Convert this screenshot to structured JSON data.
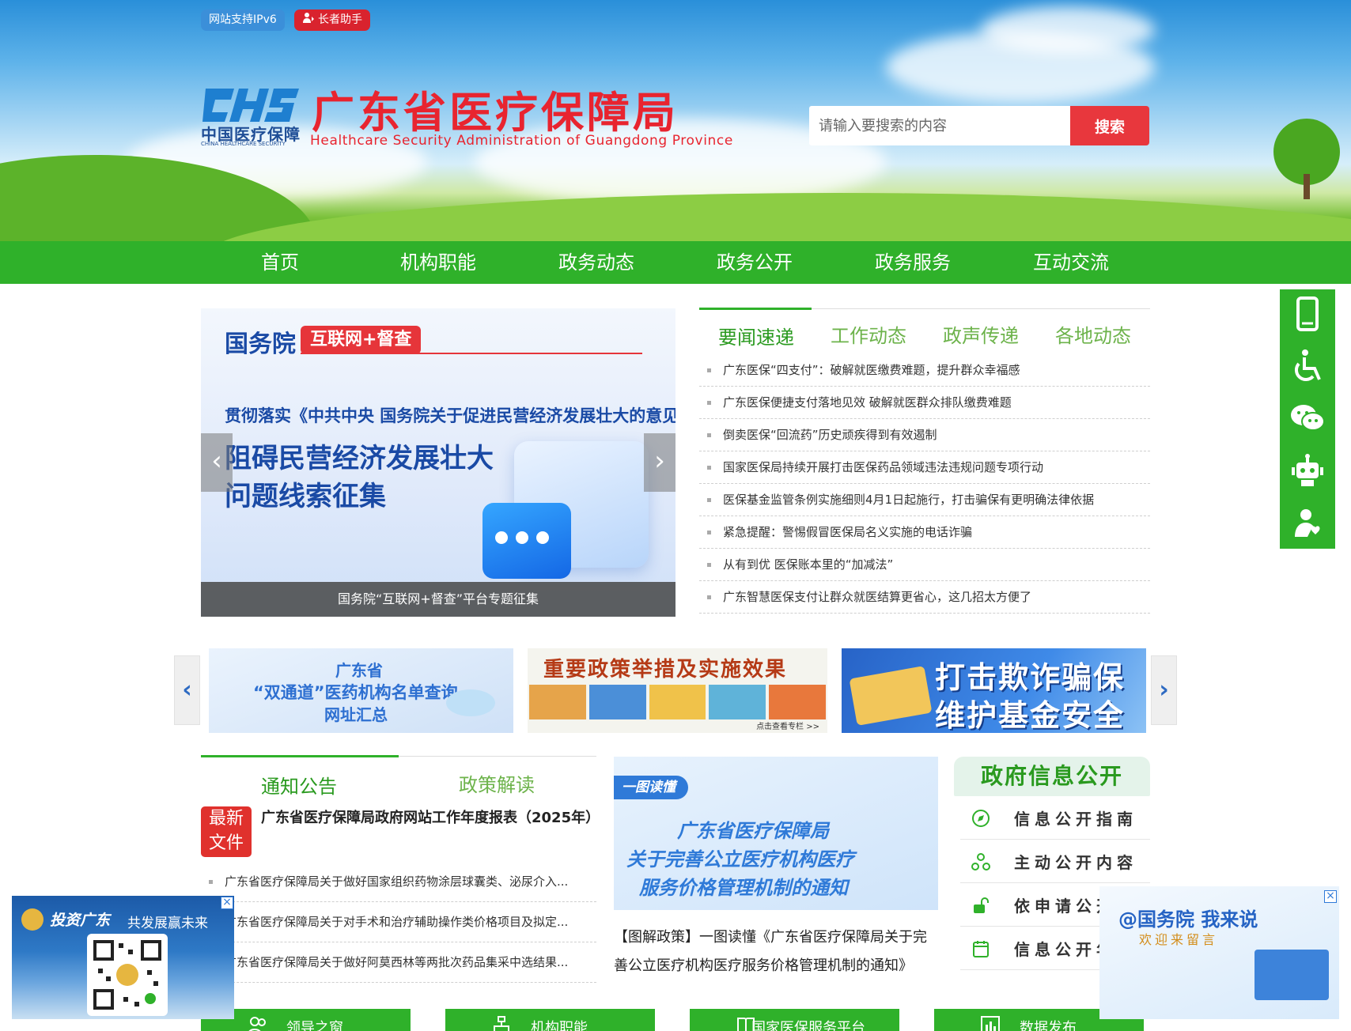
{
  "header": {
    "badge_ipv6": "网站支持IPv6",
    "badge_elder": "长者助手",
    "logo_cn": "中国医疗保障",
    "logo_en": "CHINA HEALTHCARE SECURITY",
    "title": "广东省医疗保障局",
    "subtitle": "Healthcare Security Administration of Guangdong Province",
    "search_placeholder": "请输入要搜索的内容",
    "search_button": "搜索"
  },
  "nav": [
    "首页",
    "机构职能",
    "政务动态",
    "政务公开",
    "政务服务",
    "互动交流"
  ],
  "hero": {
    "header_left": "国务院",
    "header_tag": "互联网+督查",
    "line1": "贯彻落实《中共中央 国务院关于促进民营经济发展壮大的意见》",
    "line2": "阻碍民营经济发展壮大",
    "line3": "问题线索征集",
    "caption": "国务院“互联网+督查”平台专题征集"
  },
  "news": {
    "tabs": [
      "要闻速递",
      "工作动态",
      "政声传递",
      "各地动态"
    ],
    "active_tab": "要闻速递",
    "items": [
      "广东医保“四支付”：破解就医缴费难题，提升群众幸福感",
      "广东医保便捷支付落地见效 破解就医群众排队缴费难题",
      "倒卖医保“回流药”历史顽疾得到有效遏制",
      "国家医保局持续开展打击医保药品领域违法违规问题专项行动",
      "医保基金监管条例实施细则4月1日起施行，打击骗保有更明确法律依据",
      "紧急提醒：警惕假冒医保局名义实施的电话诈骗",
      "从有到优 医保账本里的“加减法”",
      "广东智慧医保支付让群众就医结算更省心，这几招太方便了"
    ]
  },
  "float_bar": [
    "mobile-icon",
    "accessibility-icon",
    "wechat-icon",
    "robot-icon",
    "elder-care-icon"
  ],
  "banners": {
    "b1": {
      "line1": "广东省",
      "line2": "“双通道”医药机构名单查询",
      "line3": "网址汇总"
    },
    "b2": {
      "title": "重要政策举措及实施效果",
      "note": "点击查看专栏 >>"
    },
    "b3": {
      "line1": "打击欺诈骗保",
      "line2": "维护基金安全"
    }
  },
  "notices": {
    "tabs": [
      "通知公告",
      "政策解读"
    ],
    "active_tab": "通知公告",
    "latest_tag_1": "最新",
    "latest_tag_2": "文件",
    "latest_title": "广东省医疗保障局政府网站工作年度报表（2025年）",
    "items": [
      "广东省医疗保障局关于做好国家组织药物涂层球囊类、泌尿介入...",
      "广东省医疗保障局关于对手术和治疗辅助操作类价格项目及拟定...",
      "广东省医疗保障局关于做好阿莫西林等两批次药品集采中选结果..."
    ]
  },
  "infographic": {
    "tag": "一图读懂",
    "line1": "广东省医疗保障局",
    "line2": "关于完善公立医疗机构医疗",
    "line3": "服务价格管理机制的通知",
    "text": "【图解政策】一图读懂《广东省医疗保障局关于完善公立医疗机构医疗服务价格管理机制的通知》"
  },
  "gov_info": {
    "title": "政府信息公开",
    "items": [
      "信息公开指南",
      "主动公开内容",
      "依申请公开",
      "信息公开年报"
    ]
  },
  "bottom_buttons": [
    "领导之窗",
    "机构职能",
    "国家医保服务平台",
    "数据发布"
  ],
  "popup_left": {
    "title": "投资广东",
    "subtitle": "共发展赢未来"
  },
  "popup_right": {
    "title": "@国务院 我来说",
    "subtitle": "欢迎来留言"
  },
  "colors": {
    "nav_green": "#2fb12a",
    "title_red": "#e8242f",
    "search_red": "#e8373d",
    "link_blue": "#2d6fd1"
  }
}
